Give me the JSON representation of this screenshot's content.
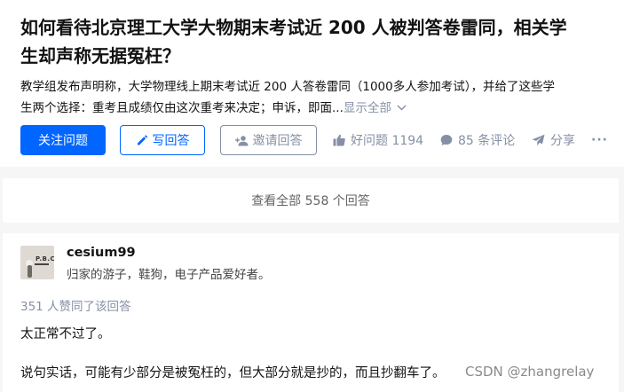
{
  "question": {
    "title_line1": "如何看待北京理工大学大物期末考试近 200 人被判答卷雷同，相关学",
    "title_line2": "生却声称无据冤枉？",
    "detail_line1": "教学组发布声明称，大学物理线上期末考试近 200 人答卷雷同（1000多人参加考试），并给了这些学",
    "detail_line2": "生两个选择：重考且成绩仅由这次重考来决定；申诉，即面...",
    "show_all": "显示全部"
  },
  "actions": {
    "follow": "关注问题",
    "answer": "写回答",
    "invite": "邀请回答",
    "good_question": "好问题 1194",
    "comments": "85 条评论",
    "share": "分享",
    "more": "···"
  },
  "view_all": "查看全部 558 个回答",
  "answer": {
    "avatar_text": "P.B.C",
    "author": "cesium99",
    "bio": "归家的游子，鞋狗，电子产品爱好者。",
    "votes": "351 人赞同了该回答",
    "para1": "太正常不过了。",
    "para2": "说句实话，可能有少部分是被冤枉的，但大部分就是抄的，而且抄翻车了。"
  },
  "watermark": "CSDN @zhangrelay",
  "colors": {
    "primary": "#0066ff",
    "muted": "#8590a6",
    "background": "#f6f6f6"
  },
  "icons": [
    "pencil-icon",
    "add-user-icon",
    "thumb-up-icon",
    "comment-icon",
    "share-icon",
    "more-icon",
    "chevron-down-icon"
  ]
}
